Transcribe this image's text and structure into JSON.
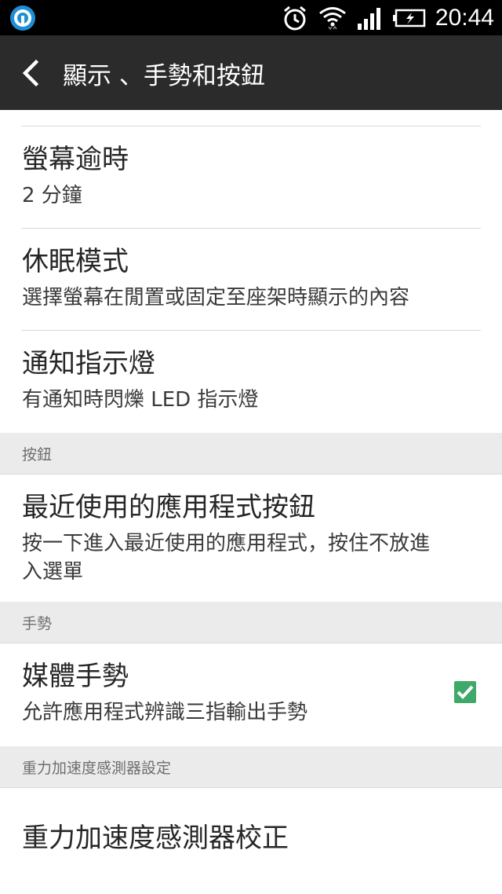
{
  "status_bar": {
    "time": "20:44",
    "icons": [
      "app-notification-icon",
      "alarm-clock-icon",
      "wifi-icon",
      "signal-bars-icon",
      "battery-charging-icon"
    ]
  },
  "action_bar": {
    "title": "顯示 、手勢和按鈕",
    "back_icon": "chevron-left-icon"
  },
  "items": [
    {
      "title": "螢幕逾時",
      "subtitle": "2 分鐘"
    },
    {
      "title": "休眠模式",
      "subtitle": "選擇螢幕在閒置或固定至座架時顯示的內容"
    },
    {
      "title": "通知指示燈",
      "subtitle": "有通知時閃爍 LED 指示燈"
    }
  ],
  "sections": {
    "buttons": "按鈕",
    "gestures": "手勢",
    "gsensor": "重力加速度感測器設定"
  },
  "recent_apps": {
    "title": "最近使用的應用程式按鈕",
    "subtitle_line1": "按一下進入最近使用的應用程式，按住不放進",
    "subtitle_line2": "入選單"
  },
  "media_gesture": {
    "title": "媒體手勢",
    "subtitle": "允許應用程式辨識三指輸出手勢",
    "checked": true
  },
  "gsensor_calibration": {
    "title": "重力加速度感測器校正"
  },
  "colors": {
    "status_bar_bg": "#000000",
    "action_bar_bg": "#2b2b2b",
    "section_bg": "#ebebeb",
    "checkbox_green": "#3fa96a"
  }
}
